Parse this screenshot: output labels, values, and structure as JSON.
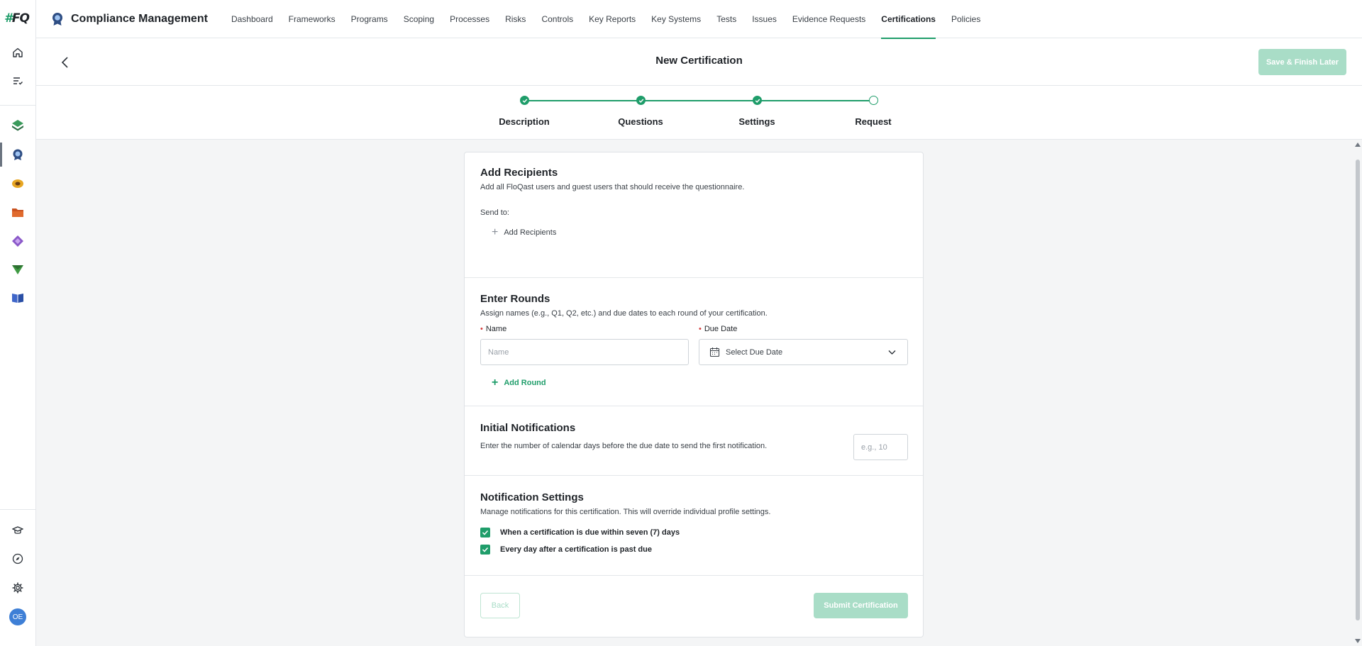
{
  "rail": {
    "logo_hash": "#",
    "logo_text": "FQ",
    "avatar_initials": "OE"
  },
  "topnav": {
    "app_title": "Compliance Management",
    "items": [
      {
        "label": "Dashboard"
      },
      {
        "label": "Frameworks"
      },
      {
        "label": "Programs"
      },
      {
        "label": "Scoping"
      },
      {
        "label": "Processes"
      },
      {
        "label": "Risks"
      },
      {
        "label": "Controls"
      },
      {
        "label": "Key Reports"
      },
      {
        "label": "Key Systems"
      },
      {
        "label": "Tests"
      },
      {
        "label": "Issues"
      },
      {
        "label": "Evidence Requests"
      },
      {
        "label": "Certifications"
      },
      {
        "label": "Policies"
      }
    ],
    "active": "Certifications"
  },
  "header": {
    "title": "New Certification",
    "save_label": "Save & Finish Later"
  },
  "stepper": {
    "steps": [
      {
        "label": "Description",
        "status": "complete"
      },
      {
        "label": "Questions",
        "status": "complete"
      },
      {
        "label": "Settings",
        "status": "complete"
      },
      {
        "label": "Request",
        "status": "current"
      }
    ]
  },
  "recipients": {
    "title": "Add Recipients",
    "description": "Add all FloQast users and guest users that should receive the questionnaire.",
    "send_to_label": "Send to:",
    "add_label": "Add Recipients"
  },
  "rounds": {
    "title": "Enter Rounds",
    "description": "Assign names (e.g., Q1, Q2, etc.) and due dates to each round of your certification.",
    "name_label": "Name",
    "name_placeholder": "Name",
    "name_value": "",
    "due_label": "Due Date",
    "due_placeholder": "Select Due Date",
    "add_round_label": "Add Round"
  },
  "initial_notifications": {
    "title": "Initial Notifications",
    "description": "Enter the number of calendar days before the due date to send the first notification.",
    "placeholder": "e.g., 10"
  },
  "notification_settings": {
    "title": "Notification Settings",
    "description": "Manage notifications for this certification. This will override individual profile settings.",
    "options": [
      {
        "label": "When a certification is due within seven (7) days",
        "checked": true
      },
      {
        "label": "Every day after a certification is past due",
        "checked": true
      }
    ]
  },
  "footer": {
    "back_label": "Back",
    "submit_label": "Submit Certification"
  },
  "colors": {
    "accent": "#1f9d6a",
    "accent_disabled": "#a9ddc7",
    "content_bg": "#f4f5f6",
    "avatar": "#3e7fd6"
  }
}
